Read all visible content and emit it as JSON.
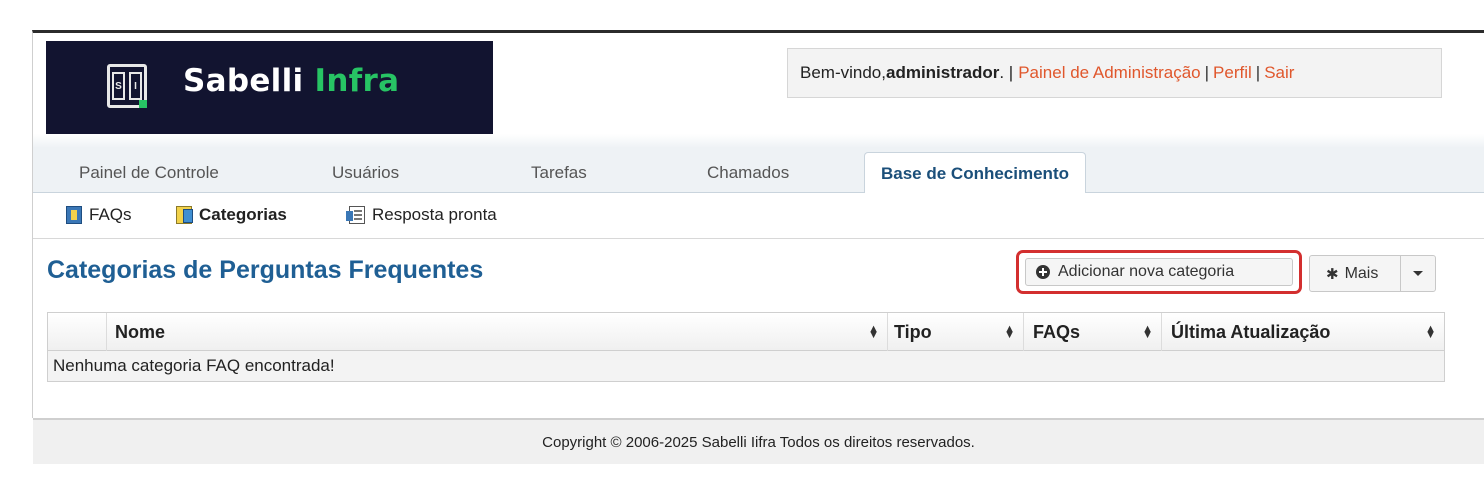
{
  "brand": {
    "name_main": "Sabelli",
    "name_accent": "Infra",
    "mark_letter_left": "S",
    "mark_letter_right": "I"
  },
  "welcome": {
    "prefix": "Bem-vindo, ",
    "user": "administrador",
    "suffix": ". |",
    "admin_link": "Painel de Administração",
    "profile_link": "Perfil",
    "logout_link": "Sair",
    "sep": "|"
  },
  "tabs": [
    {
      "label": "Painel de Controle",
      "active": false
    },
    {
      "label": "Usuários",
      "active": false
    },
    {
      "label": "Tarefas",
      "active": false
    },
    {
      "label": "Chamados",
      "active": false
    },
    {
      "label": "Base de Conhecimento",
      "active": true
    }
  ],
  "subnav": [
    {
      "label": "FAQs",
      "icon": "faq-icon",
      "active": false
    },
    {
      "label": "Categorias",
      "icon": "categories-icon",
      "active": true
    },
    {
      "label": "Resposta pronta",
      "icon": "canned-response-icon",
      "active": false
    }
  ],
  "page": {
    "title": "Categorias de Perguntas Frequentes",
    "add_button": "Adicionar nova categoria",
    "more_button": "Mais"
  },
  "table": {
    "columns": [
      "Nome",
      "Tipo",
      "FAQs",
      "Última Atualização"
    ],
    "empty_message": "Nenhuma categoria FAQ encontrada!"
  },
  "footer": {
    "copyright": "Copyright © 2006-2025 Sabelli Iifra Todos os direitos reservados."
  },
  "colors": {
    "brand_dark": "#121430",
    "brand_accent": "#27c464",
    "link": "#e0572c",
    "title": "#1f5f94",
    "highlight": "#d32f2f"
  }
}
